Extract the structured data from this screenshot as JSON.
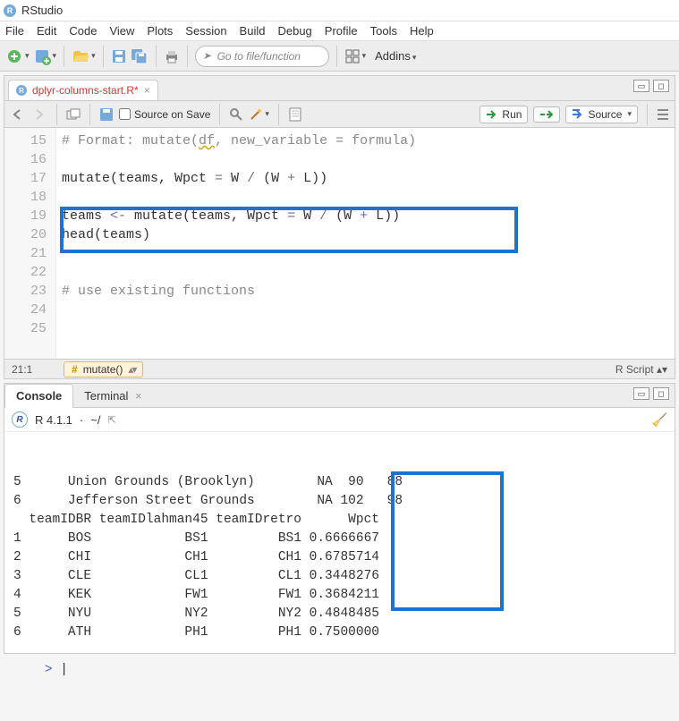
{
  "app": {
    "title": "RStudio"
  },
  "menubar": [
    "File",
    "Edit",
    "Code",
    "View",
    "Plots",
    "Session",
    "Build",
    "Debug",
    "Profile",
    "Tools",
    "Help"
  ],
  "toolbar": {
    "gotofile_placeholder": "Go to file/function",
    "addins_label": "Addins"
  },
  "editor": {
    "tab_filename": "dplyr-columns-start.R*",
    "source_on_save_label": "Source on Save",
    "run_label": "Run",
    "source_label": "Source",
    "line_start": 15,
    "lines": [
      {
        "n": 15,
        "parts": [
          {
            "t": "# Format: mutate(",
            "c": "c-comment"
          },
          {
            "t": "df",
            "c": "c-comment",
            "u": true
          },
          {
            "t": ", new_variable = formula)",
            "c": "c-comment"
          }
        ]
      },
      {
        "n": 16,
        "parts": []
      },
      {
        "n": 17,
        "parts": [
          {
            "t": "mutate(teams, Wpct "
          },
          {
            "t": "=",
            "c": "c-op"
          },
          {
            "t": " W "
          },
          {
            "t": "/",
            "c": "c-op"
          },
          {
            "t": " (W "
          },
          {
            "t": "+",
            "c": "c-op"
          },
          {
            "t": " L))"
          }
        ]
      },
      {
        "n": 18,
        "parts": []
      },
      {
        "n": 19,
        "parts": [
          {
            "t": "teams "
          },
          {
            "t": "<-",
            "c": "c-op"
          },
          {
            "t": " mutate(teams, Wpct "
          },
          {
            "t": "=",
            "c": "c-op"
          },
          {
            "t": " W "
          },
          {
            "t": "/",
            "c": "c-op"
          },
          {
            "t": " (W "
          },
          {
            "t": "+",
            "c": "c-op"
          },
          {
            "t": " L))"
          }
        ]
      },
      {
        "n": 20,
        "parts": [
          {
            "t": "head(teams)"
          }
        ]
      },
      {
        "n": 21,
        "parts": []
      },
      {
        "n": 22,
        "parts": []
      },
      {
        "n": 23,
        "parts": [
          {
            "t": "# use existing functions",
            "c": "c-comment"
          }
        ]
      },
      {
        "n": 24,
        "parts": []
      },
      {
        "n": 25,
        "parts": []
      }
    ],
    "status_pos": "21:1",
    "status_fn": "mutate()",
    "status_lang": "R Script"
  },
  "console": {
    "tab_console": "Console",
    "tab_terminal": "Terminal",
    "version": "R 4.1.1",
    "path": "~/",
    "lines": [
      "5      Union Grounds (Brooklyn)        NA  90   88",
      "6      Jefferson Street Grounds        NA 102   98",
      "  teamIDBR teamIDlahman45 teamIDretro      Wpct",
      "1      BOS            BS1         BS1 0.6666667",
      "2      CHI            CH1         CH1 0.6785714",
      "3      CLE            CL1         CL1 0.3448276",
      "4      KEK            FW1         FW1 0.3684211",
      "5      NYU            NY2         NY2 0.4848485",
      "6      ATH            PH1         PH1 0.7500000"
    ],
    "prompt": "> "
  },
  "chart_data": {
    "type": "table",
    "title": "Subset of head(teams) output with new Wpct column",
    "columns": [
      "teamIDBR",
      "teamIDlahman45",
      "teamIDretro",
      "Wpct"
    ],
    "rows": [
      [
        "BOS",
        "BS1",
        "BS1",
        0.6666667
      ],
      [
        "CHI",
        "CH1",
        "CH1",
        0.6785714
      ],
      [
        "CLE",
        "CL1",
        "CL1",
        0.3448276
      ],
      [
        "KEK",
        "FW1",
        "FW1",
        0.3684211
      ],
      [
        "NYU",
        "NY2",
        "NY2",
        0.4848485
      ],
      [
        "ATH",
        "PH1",
        "PH1",
        0.75
      ]
    ]
  }
}
